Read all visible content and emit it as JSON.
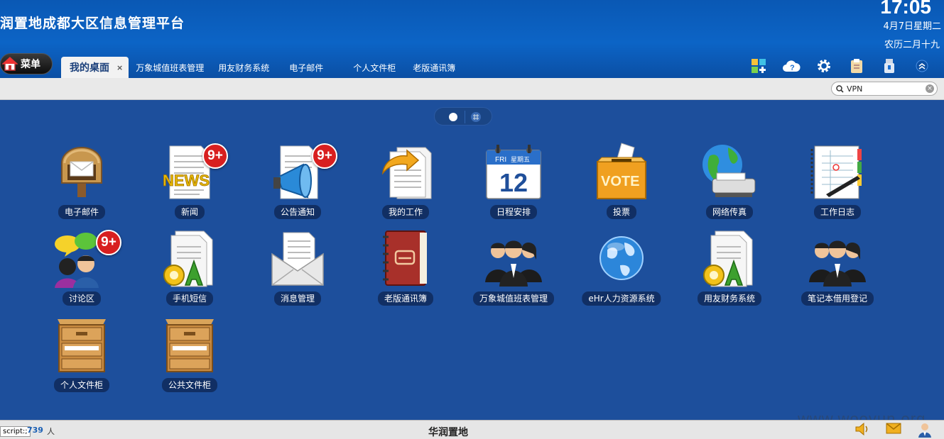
{
  "header": {
    "title": "润置地成都大区信息管理平台",
    "clock": "17:05",
    "date": "4月7日星期二",
    "lunar": "农历二月十九"
  },
  "menu": {
    "label": "菜单",
    "icon": "home-icon"
  },
  "tabs": [
    {
      "label": "我的桌面",
      "active": true,
      "close": "×"
    },
    {
      "label": "万象城值班表管理"
    },
    {
      "label": "用友财务系统"
    },
    {
      "label": "电子邮件"
    },
    {
      "label": "个人文件柜"
    },
    {
      "label": "老版通讯簿"
    }
  ],
  "toolbar": [
    {
      "icon": "add-app-icon"
    },
    {
      "icon": "cloud-help-icon"
    },
    {
      "icon": "gear-icon"
    },
    {
      "icon": "clipboard-icon"
    },
    {
      "icon": "usb-icon"
    },
    {
      "icon": "collapse-up-icon"
    }
  ],
  "search": {
    "value": "VPN",
    "placeholder": ""
  },
  "apps": [
    {
      "label": "电子邮件",
      "icon": "mailbox-icon"
    },
    {
      "label": "新闻",
      "icon": "news-icon",
      "badge": "9+"
    },
    {
      "label": "公告通知",
      "icon": "megaphone-icon",
      "badge": "9+"
    },
    {
      "label": "我的工作",
      "icon": "work-documents-icon"
    },
    {
      "label": "日程安排",
      "icon": "calendar-icon",
      "cal_day": "FRI",
      "cal_week": "星期五",
      "cal_date": "12"
    },
    {
      "label": "投票",
      "icon": "vote-box-icon",
      "vote_text": "VOTE"
    },
    {
      "label": "网络传真",
      "icon": "globe-fax-icon"
    },
    {
      "label": "工作日志",
      "icon": "notebook-icon"
    },
    {
      "label": "讨论区",
      "icon": "discussion-icon",
      "badge": "9+"
    },
    {
      "label": "手机短信",
      "icon": "oa-doc-icon",
      "oa": "OA"
    },
    {
      "label": "消息管理",
      "icon": "envelope-icon"
    },
    {
      "label": "老版通讯簿",
      "icon": "address-book-icon"
    },
    {
      "label": "万象城值班表管理",
      "icon": "people-group-icon"
    },
    {
      "label": "eHr人力资源系统",
      "icon": "globe-icon"
    },
    {
      "label": "用友财务系统",
      "icon": "oa-doc-icon",
      "oa": "OA"
    },
    {
      "label": "笔记本借用登记",
      "icon": "people-group-icon"
    },
    {
      "label": "个人文件柜",
      "icon": "cabinet-icon"
    },
    {
      "label": "公共文件柜",
      "icon": "cabinet-icon"
    }
  ],
  "footer": {
    "status_tip": "script:;",
    "online_count": "739",
    "online_unit": "人",
    "company": "华润置地",
    "icons": [
      "speaker-icon",
      "mail-icon",
      "user-icon"
    ]
  },
  "watermark": "www.wooyun.org",
  "colors": {
    "header": "#0c64c6",
    "desktop": "#1d4f9c",
    "badge": "#d81f1f"
  }
}
